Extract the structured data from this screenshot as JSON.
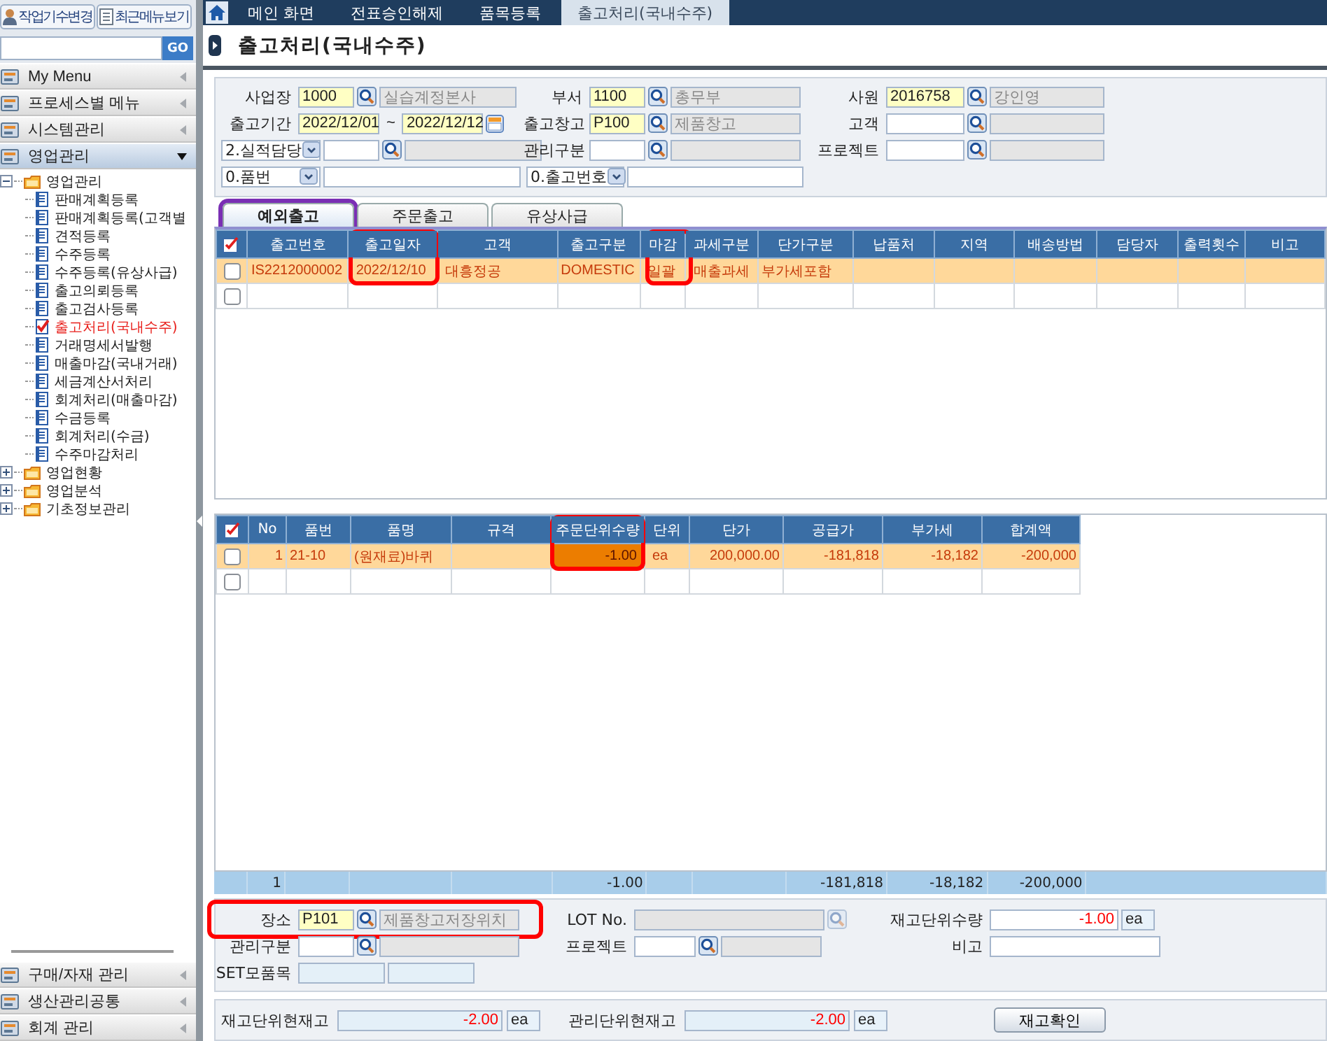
{
  "sidebar": {
    "top_buttons": [
      "작업기수변경",
      "최근메뉴보기"
    ],
    "search_button": "GO",
    "menus": [
      {
        "label": "My Menu",
        "expanded": false
      },
      {
        "label": "프로세스별 메뉴",
        "expanded": false
      },
      {
        "label": "시스템관리",
        "expanded": false
      },
      {
        "label": "영업관리",
        "expanded": true
      }
    ],
    "tree": [
      {
        "label": "영업관리",
        "expanded": true,
        "children": [
          {
            "label": "판매계획등록",
            "selected": false
          },
          {
            "label": "판매계획등록(고객별",
            "selected": false
          },
          {
            "label": "견적등록",
            "selected": false
          },
          {
            "label": "수주등록",
            "selected": false
          },
          {
            "label": "수주등록(유상사급)",
            "selected": false
          },
          {
            "label": "출고의뢰등록",
            "selected": false
          },
          {
            "label": "출고검사등록",
            "selected": false
          },
          {
            "label": "출고처리(국내수주)",
            "selected": true
          },
          {
            "label": "거래명세서발행",
            "selected": false
          },
          {
            "label": "매출마감(국내거래)",
            "selected": false
          },
          {
            "label": "세금계산서처리",
            "selected": false
          },
          {
            "label": "회계처리(매출마감)",
            "selected": false
          },
          {
            "label": "수금등록",
            "selected": false
          },
          {
            "label": "회계처리(수금)",
            "selected": false
          },
          {
            "label": "수주마감처리",
            "selected": false
          }
        ]
      },
      {
        "label": "영업현황",
        "expanded": false
      },
      {
        "label": "영업분석",
        "expanded": false
      },
      {
        "label": "기초정보관리",
        "expanded": false
      }
    ],
    "bottom_menus": [
      {
        "label": "구매/자재 관리",
        "expanded": false
      },
      {
        "label": "생산관리공통",
        "expanded": false
      },
      {
        "label": "회계 관리",
        "expanded": false
      }
    ]
  },
  "tabs": [
    {
      "label": "메인 화면",
      "selected": false
    },
    {
      "label": "전표승인해제",
      "selected": false
    },
    {
      "label": "품목등록",
      "selected": false
    },
    {
      "label": "출고처리(국내수주)",
      "selected": true
    }
  ],
  "page_title": "출고처리(국내수주)",
  "filters": {
    "rows": [
      [
        {
          "kind": "lookup",
          "label": "사업장",
          "code": "1000",
          "name": "실습계정본사",
          "required": true
        },
        {
          "kind": "lookup",
          "label": "부서",
          "code": "1100",
          "name": "총무부",
          "required": true
        },
        {
          "kind": "lookup",
          "label": "사원",
          "code": "2016758",
          "name": "강인영",
          "required": true
        }
      ],
      [
        {
          "kind": "daterange",
          "label": "출고기간",
          "from": "2022/12/01",
          "separator": "~",
          "to": "2022/12/12",
          "required": true
        },
        {
          "kind": "lookup",
          "label": "출고창고",
          "code": "P100",
          "name": "제품창고",
          "required": true
        },
        {
          "kind": "lookup",
          "label": "고객",
          "required": false
        }
      ],
      [
        {
          "kind": "select_lookup",
          "select": "2.실적담당",
          "required": false
        },
        {
          "kind": "lookup",
          "label": "관리구분",
          "required": false
        },
        {
          "kind": "lookup",
          "label": "프로젝트",
          "required": false
        }
      ],
      [
        {
          "kind": "select_text",
          "select": "0.품번"
        },
        {
          "kind": "select_text",
          "select": "0.출고번호"
        }
      ]
    ]
  },
  "subtabs": [
    {
      "label": "예외출고",
      "selected": true,
      "highlighted": true
    },
    {
      "label": "주문출고",
      "selected": false,
      "highlighted": false
    },
    {
      "label": "유상사급",
      "selected": false,
      "highlighted": false
    }
  ],
  "shipments": {
    "columns": [
      {
        "label": "출고번호",
        "highlighted": false
      },
      {
        "label": "출고일자",
        "highlighted": true
      },
      {
        "label": "고객",
        "highlighted": false
      },
      {
        "label": "출고구분",
        "highlighted": false
      },
      {
        "label": "마감",
        "highlighted": true
      },
      {
        "label": "과세구분",
        "highlighted": false
      },
      {
        "label": "단가구분",
        "highlighted": false
      },
      {
        "label": "납품처",
        "highlighted": false
      },
      {
        "label": "지역",
        "highlighted": false
      },
      {
        "label": "배송방법",
        "highlighted": false
      },
      {
        "label": "담당자",
        "highlighted": false
      },
      {
        "label": "출력횟수",
        "highlighted": false
      },
      {
        "label": "비고",
        "highlighted": false
      }
    ],
    "rows": [
      {
        "checked": false,
        "selected": true,
        "cells": [
          "IS2212000002",
          "2022/12/10",
          "대흥정공",
          "DOMESTIC",
          "일괄",
          "매출과세",
          "부가세포함"
        ]
      },
      {
        "checked": false,
        "selected": false
      }
    ]
  },
  "items": {
    "columns": [
      {
        "label": "No",
        "highlighted": false
      },
      {
        "label": "품번",
        "highlighted": false
      },
      {
        "label": "품명",
        "highlighted": false
      },
      {
        "label": "규격",
        "highlighted": false
      },
      {
        "label": "주문단위수량",
        "highlighted": true
      },
      {
        "label": "단위",
        "highlighted": false
      },
      {
        "label": "단가",
        "highlighted": false
      },
      {
        "label": "공급가",
        "highlighted": false
      },
      {
        "label": "부가세",
        "highlighted": false
      },
      {
        "label": "합계액",
        "highlighted": false
      }
    ],
    "rows": [
      {
        "checked": false,
        "selected": true,
        "cells": [
          "1",
          "21-10",
          "(원재료)바퀴",
          "",
          {
            "text": "-1.00",
            "focused": true
          },
          "ea",
          "200,000.00",
          "-181,818",
          "-18,182",
          "-200,000"
        ]
      },
      {
        "checked": false,
        "selected": false
      }
    ],
    "totals": {
      "0": "1",
      "4": "-1.00",
      "7": "-181,818",
      "8": "-18,182",
      "9": "-200,000"
    }
  },
  "detail": {
    "fields": [
      {
        "kind": "lookup",
        "label": "장소",
        "code": "P101",
        "name": "제품창고저장위치",
        "required": true,
        "disabled": false,
        "highlighted": true
      },
      {
        "kind": "lookup",
        "label": "LOT No.",
        "disabled": true,
        "highlighted": false
      },
      {
        "kind": "qty",
        "label": "재고단위수량",
        "value": "-1.00",
        "unit": "ea"
      },
      {
        "kind": "lookup",
        "label": "관리구분",
        "required": false,
        "disabled": false,
        "highlighted": false
      },
      {
        "kind": "lookup",
        "label": "프로젝트",
        "required": false,
        "disabled": false,
        "highlighted": false
      },
      {
        "kind": "text",
        "label": "비고"
      },
      {
        "kind": "pair",
        "label": "SET모품목"
      }
    ]
  },
  "stock": [
    {
      "label": "재고단위현재고",
      "value": "-2.00",
      "unit": "ea"
    },
    {
      "label": "관리단위현재고",
      "value": "-2.00",
      "unit": "ea"
    }
  ],
  "stock_button": "재고확인"
}
